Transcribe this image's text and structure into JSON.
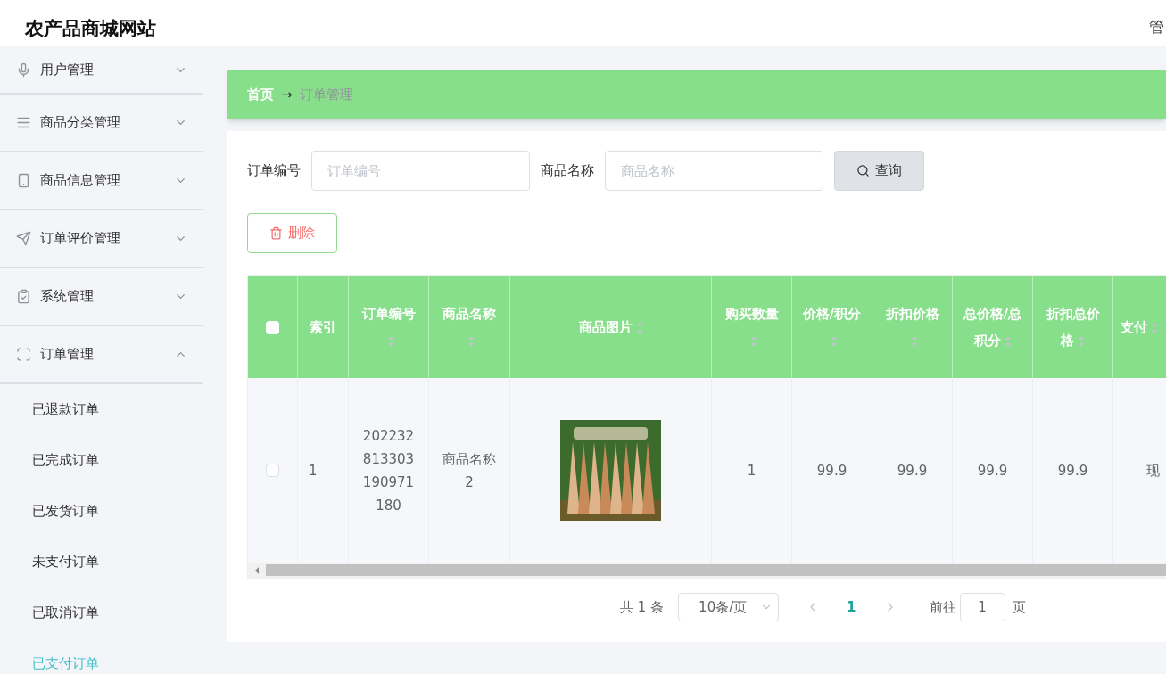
{
  "site_title": "农产品商城网站",
  "header_right": "管",
  "sidebar": {
    "items": [
      {
        "label": "用户管理",
        "expanded": false
      },
      {
        "label": "商品分类管理",
        "expanded": false
      },
      {
        "label": "商品信息管理",
        "expanded": false
      },
      {
        "label": "订单评价管理",
        "expanded": false
      },
      {
        "label": "系统管理",
        "expanded": false
      },
      {
        "label": "订单管理",
        "expanded": true,
        "children": [
          {
            "label": "已退款订单",
            "selected": false
          },
          {
            "label": "已完成订单",
            "selected": false
          },
          {
            "label": "已发货订单",
            "selected": false
          },
          {
            "label": "未支付订单",
            "selected": false
          },
          {
            "label": "已取消订单",
            "selected": false
          },
          {
            "label": "已支付订单",
            "selected": true
          }
        ]
      }
    ]
  },
  "breadcrumb": {
    "home": "首页",
    "separator": "→",
    "current": "订单管理"
  },
  "search": {
    "fields": [
      {
        "label": "订单编号",
        "placeholder": "订单编号"
      },
      {
        "label": "商品名称",
        "placeholder": "商品名称"
      }
    ],
    "button": "查询"
  },
  "delete_button": "删除",
  "table": {
    "select_all_checked": false,
    "columns": [
      {
        "label": "索引",
        "sortable": false
      },
      {
        "label": "订单编号",
        "sortable": true
      },
      {
        "label": "商品名称",
        "sortable": true
      },
      {
        "label": "商品图片",
        "sortable": true
      },
      {
        "label": "购买数量",
        "sortable": true
      },
      {
        "label": "价格/积分",
        "sortable": true
      },
      {
        "label": "折扣价格",
        "sortable": true
      },
      {
        "label": "总价格/总积分",
        "sortable": true
      },
      {
        "label": "折扣总价格",
        "sortable": true
      },
      {
        "label": "支付",
        "sortable": true
      }
    ],
    "rows": [
      {
        "checked": false,
        "cells": [
          {
            "kind": "text",
            "text": "1"
          },
          {
            "kind": "text",
            "text": "202232813303190971180"
          },
          {
            "kind": "text",
            "text": "商品名称2"
          },
          {
            "kind": "picture"
          },
          {
            "kind": "text",
            "text": "1"
          },
          {
            "kind": "text",
            "text": "99.9"
          },
          {
            "kind": "text",
            "text": "99.9"
          },
          {
            "kind": "text",
            "text": "99.9"
          },
          {
            "kind": "text",
            "text": "99.9"
          },
          {
            "kind": "text",
            "text": "现"
          }
        ]
      }
    ]
  },
  "pagination": {
    "total": "共 1 条",
    "page_size": "10条/页",
    "pages": [
      {
        "label": "1",
        "selected": true
      }
    ],
    "goto_label": "前往",
    "goto_value": "1",
    "goto_suffix": "页"
  }
}
